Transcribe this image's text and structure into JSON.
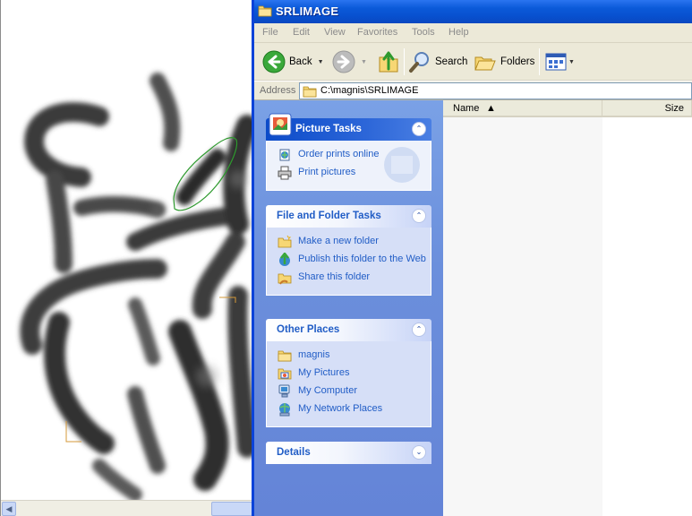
{
  "window": {
    "title": "SRLIMAGE",
    "title_icon": "folder-icon"
  },
  "menu": {
    "items": [
      "File",
      "Edit",
      "View",
      "Favorites",
      "Tools",
      "Help"
    ]
  },
  "toolbar": {
    "back_label": "Back",
    "search_label": "Search",
    "folders_label": "Folders"
  },
  "address": {
    "label": "Address",
    "value": "C:\\magnis\\SRLIMAGE"
  },
  "taskpane": {
    "picture_tasks": {
      "title": "Picture Tasks",
      "items": [
        "Order prints online",
        "Print pictures"
      ]
    },
    "file_folder_tasks": {
      "title": "File and Folder Tasks",
      "items": [
        "Make a new folder",
        "Publish this folder to the Web",
        "Share this folder"
      ]
    },
    "other_places": {
      "title": "Other Places",
      "items": [
        "magnis",
        "My Pictures",
        "My Computer",
        "My Network Places"
      ]
    },
    "details": {
      "title": "Details"
    }
  },
  "filelist": {
    "columns": [
      "Name",
      "Size"
    ]
  },
  "colors": {
    "title_blue": "#0a50d0",
    "link_blue": "#215dc6",
    "panel_body": "#d6dff7",
    "chrome": "#ece9d8",
    "selection_green": "#2e9a2e"
  }
}
